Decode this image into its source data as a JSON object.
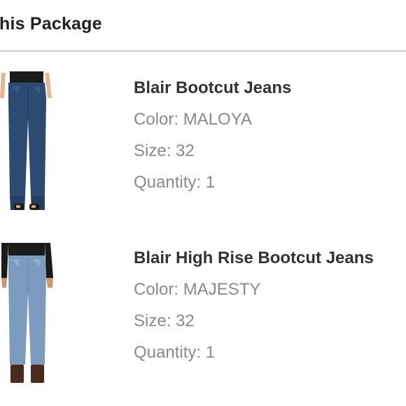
{
  "package": {
    "title": "his Package"
  },
  "items": [
    {
      "name": "Blair Bootcut Jeans",
      "color_label": "Color: MALOYA",
      "size_label": "Size: 32",
      "quantity_label": "Quantity: 1",
      "image_icon": "dark-wash-bootcut-jeans-photo"
    },
    {
      "name": "Blair High Rise Bootcut Jeans",
      "color_label": "Color: MAJESTY",
      "size_label": "Size: 32",
      "quantity_label": "Quantity: 1",
      "image_icon": "light-wash-bootcut-jeans-photo"
    }
  ],
  "colors": {
    "title_text": "#222222",
    "item_name_text": "#333333",
    "meta_text": "#8a8a8a",
    "divider": "#c8c8c8",
    "dark_denim": "#2c4a72",
    "light_denim": "#7d9bbf"
  }
}
